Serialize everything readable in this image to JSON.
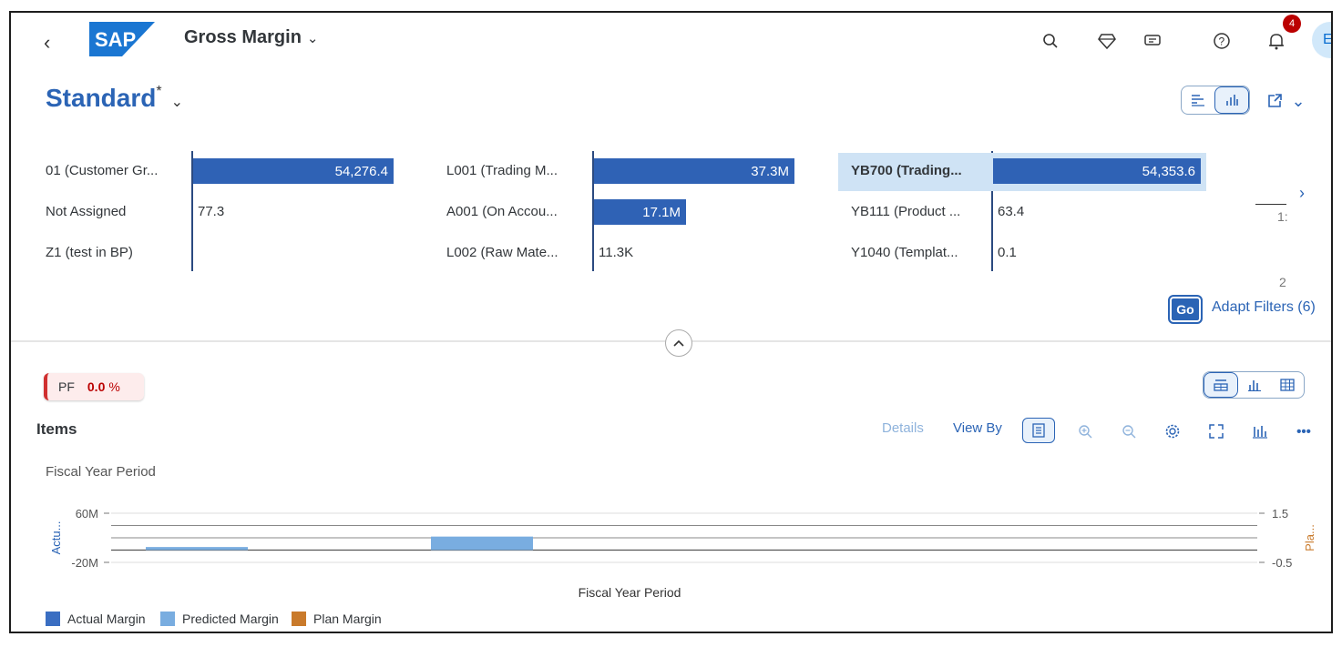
{
  "shell": {
    "app_title": "Gross Margin",
    "logo_text": "SAP",
    "notification_count": "4",
    "avatar_initials": "ES"
  },
  "variant": {
    "name": "Standard",
    "modified_marker": "*"
  },
  "filter_charts": [
    {
      "rows": [
        {
          "label": "01 (Customer Gr...",
          "value": "54,276.4",
          "fraction": 1.0,
          "inside": true
        },
        {
          "label": "Not Assigned",
          "value": "77.3",
          "fraction": 0.0,
          "inside": false
        },
        {
          "label": "Z1 (test in BP)",
          "value": "",
          "fraction": 0.0,
          "inside": false
        }
      ]
    },
    {
      "rows": [
        {
          "label": "L001 (Trading M...",
          "value": "37.3M",
          "fraction": 1.0,
          "inside": true
        },
        {
          "label": "A001 (On Accou...",
          "value": "17.1M",
          "fraction": 0.46,
          "inside": true
        },
        {
          "label": "L002 (Raw Mate...",
          "value": "11.3K",
          "fraction": 0.0,
          "inside": false
        }
      ]
    },
    {
      "rows": [
        {
          "label": "YB700 (Trading...",
          "value": "54,353.6",
          "fraction": 1.0,
          "inside": true,
          "selected": true
        },
        {
          "label": "YB111 (Product ...",
          "value": "63.4",
          "fraction": 0.0,
          "inside": false
        },
        {
          "label": "Y1040 (Templat...",
          "value": "0.1",
          "fraction": 0.0,
          "inside": false
        }
      ]
    }
  ],
  "filter_overflow": {
    "a": "1:",
    "b": "2"
  },
  "go_label": "Go",
  "adapt_filters_label": "Adapt Filters (6)",
  "kpi": {
    "label": "PF",
    "value": "0.0",
    "unit": "%"
  },
  "items_title": "Items",
  "toolbar": {
    "details": "Details",
    "view_by": "View By"
  },
  "chart_data": {
    "type": "bar",
    "title": "Fiscal Year Period",
    "xlabel": "Fiscal Year Period",
    "ylabel": "Actu...",
    "y2label": "Pla...",
    "ylim": [
      -20,
      60
    ],
    "y2lim": [
      -0.5,
      1.5
    ],
    "y_ticks": [
      "60M",
      "-20M"
    ],
    "y2_ticks": [
      "1.5",
      "-0.5"
    ],
    "categories": [
      "",
      "",
      ""
    ],
    "series": [
      {
        "name": "Actual Margin",
        "color": "#3a6ec2",
        "values": [
          0,
          0,
          0
        ]
      },
      {
        "name": "Predicted Margin",
        "color": "#79ade0",
        "values": [
          5,
          22,
          0
        ]
      },
      {
        "name": "Plan Margin",
        "color": "#c97a2b",
        "values": [
          0,
          0,
          0
        ]
      }
    ]
  },
  "colors": {
    "brand": "#2b64b5",
    "bar": "#2f62b5",
    "kpi_error": "#bb0000"
  }
}
